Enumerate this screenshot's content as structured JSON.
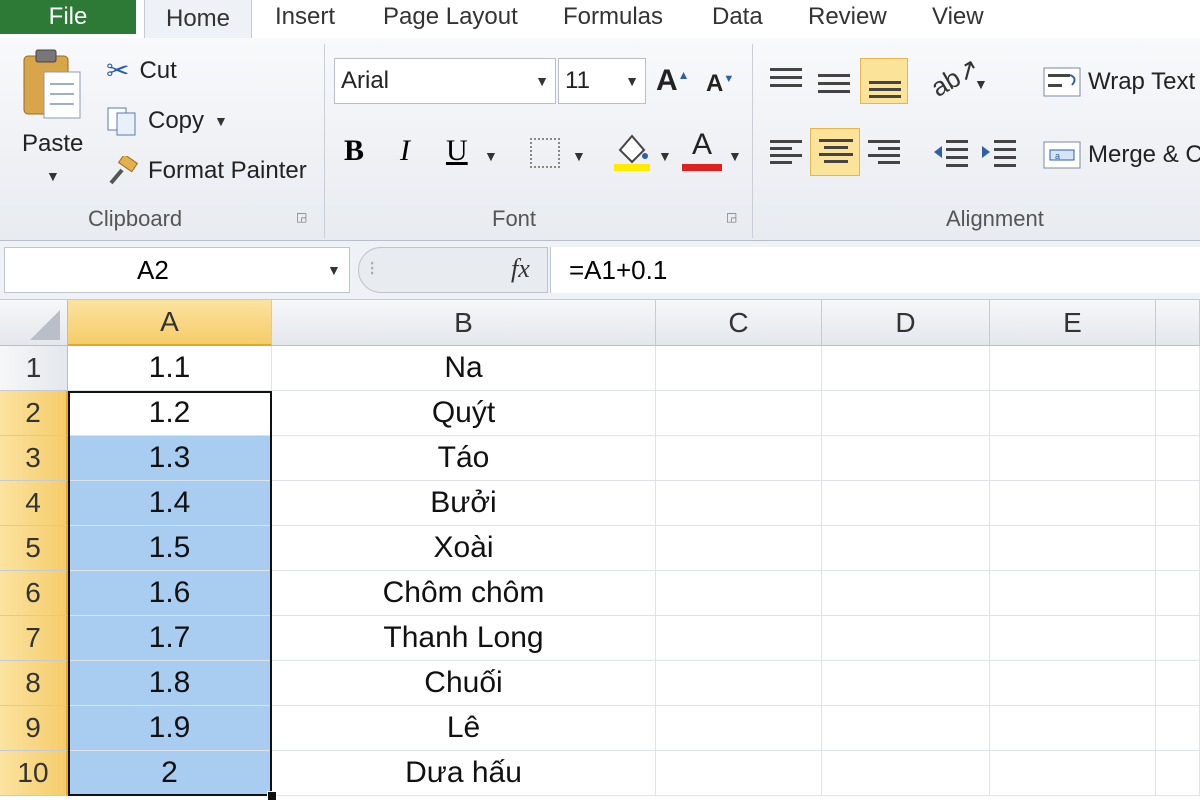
{
  "tabs": [
    "File",
    "Home",
    "Insert",
    "Page Layout",
    "Formulas",
    "Data",
    "Review",
    "View"
  ],
  "clipboard": {
    "paste": "Paste",
    "cut": "Cut",
    "copy": "Copy",
    "format_painter": "Format Painter",
    "group": "Clipboard"
  },
  "font": {
    "family": "Arial",
    "size": "11",
    "group": "Font",
    "bold": "B",
    "italic": "I",
    "underline": "U",
    "font_color_letter": "A"
  },
  "alignment": {
    "wrap": "Wrap Text",
    "merge": "Merge & C",
    "group": "Alignment"
  },
  "formula_bar": {
    "name_box": "A2",
    "fx": "fx",
    "formula": "=A1+0.1"
  },
  "columns": [
    "A",
    "B",
    "C",
    "D",
    "E"
  ],
  "rows": [
    "1",
    "2",
    "3",
    "4",
    "5",
    "6",
    "7",
    "8",
    "9",
    "10"
  ],
  "col_a": [
    "1.1",
    "1.2",
    "1.3",
    "1.4",
    "1.5",
    "1.6",
    "1.7",
    "1.8",
    "1.9",
    "2"
  ],
  "col_b": [
    "Na",
    "Quýt",
    "Táo",
    "Bưởi",
    "Xoài",
    "Chôm chôm",
    "Thanh Long",
    "Chuối",
    "Lê",
    "Dưa hấu"
  ],
  "colors": {
    "file_tab": "#2d7a36",
    "selection": "#a8cdf0",
    "header_selected": "#f5cc6a"
  }
}
